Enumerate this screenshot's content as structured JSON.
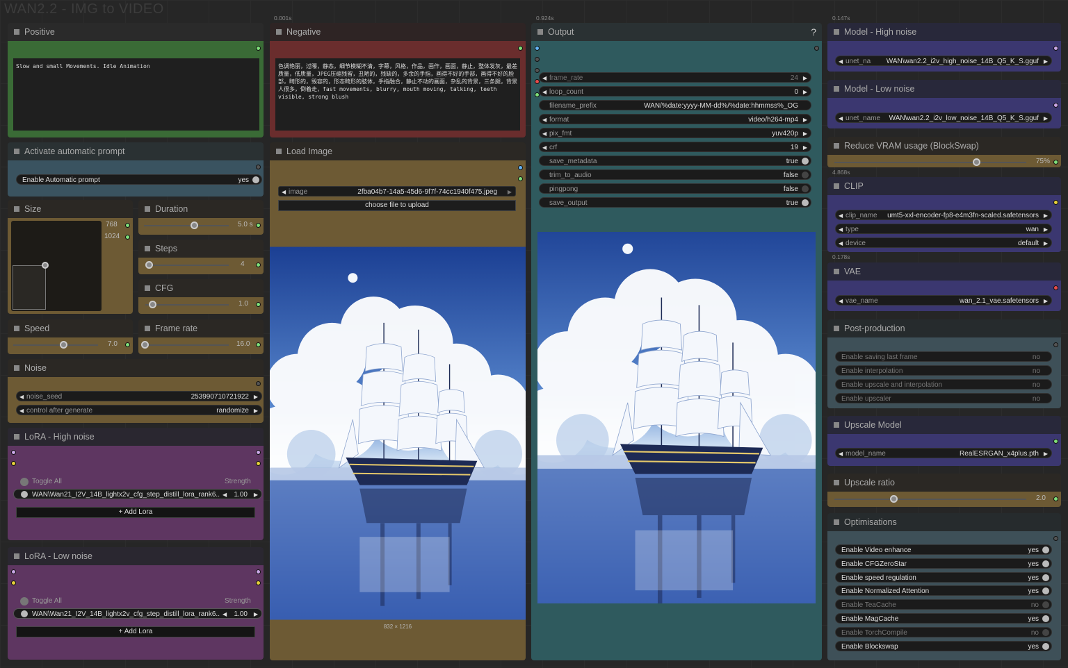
{
  "workflow_title": "WAN2.2 - IMG to VIDEO",
  "timings": {
    "negative": "0.001s",
    "output": "0.924s",
    "model_high": "0.147s",
    "reduce": "4.868s",
    "vae": "0.178s"
  },
  "positive": {
    "title": "Positive",
    "text": "Slow and small Movements. Idle Animation"
  },
  "negative": {
    "title": "Negative",
    "text": "色调艳丽，过曝，静态，细节模糊不清，字幕，风格，作品，画作，画面，静止，整体发灰，最差质量，低质量，JPEG压缩残留，丑陋的，残缺的，多余的手指，画得不好的手部，画得不好的脸部，畸形的，毁容的，形态畸形的肢体，手指融合，静止不动的画面，杂乱的背景，三条腿，背景人很多，倒着走，fast movements, blurry, mouth moving, talking, teeth visible, strong blush"
  },
  "auto_prompt": {
    "title": "Activate automatic prompt",
    "label": "Enable Automatic prompt",
    "value": "yes"
  },
  "size": {
    "title": "Size",
    "width": "768",
    "height": "1024"
  },
  "duration": {
    "title": "Duration",
    "value": "5.0 s",
    "level": 0.6
  },
  "steps": {
    "title": "Steps",
    "value": "4",
    "level": 0
  },
  "cfg": {
    "title": "CFG",
    "value": "1.0",
    "level": 0.05
  },
  "speed": {
    "title": "Speed",
    "value": "7.0",
    "level": 0.6
  },
  "frame_rate": {
    "title": "Frame rate",
    "value": "16.0",
    "level": 0
  },
  "noise": {
    "title": "Noise",
    "seed_label": "noise_seed",
    "seed_value": "253990710721922",
    "control_label": "control after generate",
    "control_value": "randomize"
  },
  "lora_high": {
    "title": "LoRA - High noise",
    "toggle": "Toggle All",
    "strength": "Strength",
    "lora": "WAN\\Wan21_I2V_14B_lightx2v_cfg_step_distill_lora_rank6...",
    "lora_value": "1.00",
    "add": "Add Lora"
  },
  "lora_low": {
    "title": "LoRA - Low noise",
    "toggle": "Toggle All",
    "strength": "Strength",
    "lora": "WAN\\Wan21_I2V_14B_lightx2v_cfg_step_distill_lora_rank6...",
    "lora_value": "1.00",
    "add": "Add Lora"
  },
  "load_image": {
    "title": "Load Image",
    "image_label": "image",
    "image_value": "2fba04b7-14a5-45d6-9f7f-74cc1940f475.jpeg",
    "upload": "choose file to upload",
    "dims": "832 × 1216"
  },
  "output": {
    "title": "Output",
    "help": "?",
    "rows": [
      {
        "label": "frame_rate",
        "value": "24",
        "kind": "arrow",
        "dim": true
      },
      {
        "label": "loop_count",
        "value": "0",
        "kind": "arrow"
      },
      {
        "label": "filename_prefix",
        "value": "WAN/%date:yyyy-MM-dd%/%date:hhmmss%_OG",
        "kind": "text"
      },
      {
        "label": "format",
        "value": "video/h264-mp4",
        "kind": "arrow"
      },
      {
        "label": "pix_fmt",
        "value": "yuv420p",
        "kind": "arrow"
      },
      {
        "label": "crf",
        "value": "19",
        "kind": "arrow"
      },
      {
        "label": "save_metadata",
        "value": "true",
        "kind": "toggle",
        "on": true
      },
      {
        "label": "trim_to_audio",
        "value": "false",
        "kind": "toggle",
        "on": false
      },
      {
        "label": "pingpong",
        "value": "false",
        "kind": "toggle",
        "on": false
      },
      {
        "label": "save_output",
        "value": "true",
        "kind": "toggle",
        "on": true
      }
    ]
  },
  "model_high": {
    "title": "Model - High noise",
    "label": "unet_na",
    "value": "WAN\\wan2.2_i2v_high_noise_14B_Q5_K_S.gguf"
  },
  "model_low": {
    "title": "Model - Low noise",
    "label": "unet_name",
    "value": "WAN\\wan2.2_i2v_low_noise_14B_Q5_K_S.gguf"
  },
  "reduce_vram": {
    "title": "Reduce VRAM usage (BlockSwap)",
    "value": "75%",
    "level": 0.75
  },
  "clip": {
    "title": "CLIP",
    "rows": [
      {
        "label": "clip_name",
        "value": "umt5-xxl-encoder-fp8-e4m3fn-scaled.safetensors"
      },
      {
        "label": "type",
        "value": "wan"
      },
      {
        "label": "device",
        "value": "default"
      }
    ]
  },
  "vae": {
    "title": "VAE",
    "label": "vae_name",
    "value": "wan_2.1_vae.safetensors"
  },
  "post": {
    "title": "Post-production",
    "rows": [
      {
        "label": "Enable saving last frame",
        "value": "no"
      },
      {
        "label": "Enable interpolation",
        "value": "no"
      },
      {
        "label": "Enable upscale and interpolation",
        "value": "no"
      },
      {
        "label": "Enable upscaler",
        "value": "no"
      }
    ]
  },
  "upscale_model": {
    "title": "Upscale Model",
    "label": "model_name",
    "value": "RealESRGAN_x4plus.pth"
  },
  "upscale_ratio": {
    "title": "Upscale ratio",
    "value": "2.0",
    "level": 0.3
  },
  "optim": {
    "title": "Optimisations",
    "rows": [
      {
        "label": "Enable Video enhance",
        "value": "yes",
        "on": true
      },
      {
        "label": "Enable CFGZeroStar",
        "value": "yes",
        "on": true
      },
      {
        "label": "Enable speed regulation",
        "value": "yes",
        "on": true
      },
      {
        "label": "Enable Normalized Attention",
        "value": "yes",
        "on": true
      },
      {
        "label": "Enable TeaCache",
        "value": "no",
        "on": false
      },
      {
        "label": "Enable MagCache",
        "value": "yes",
        "on": true
      },
      {
        "label": "Enable TorchCompile",
        "value": "no",
        "on": false
      },
      {
        "label": "Enable Blockswap",
        "value": "yes",
        "on": true
      }
    ]
  },
  "icons": {
    "add": "plus-icon",
    "toggle": "toggle-icon",
    "arrow_left": "arrow-left-icon",
    "arrow_right": "arrow-right-icon"
  }
}
